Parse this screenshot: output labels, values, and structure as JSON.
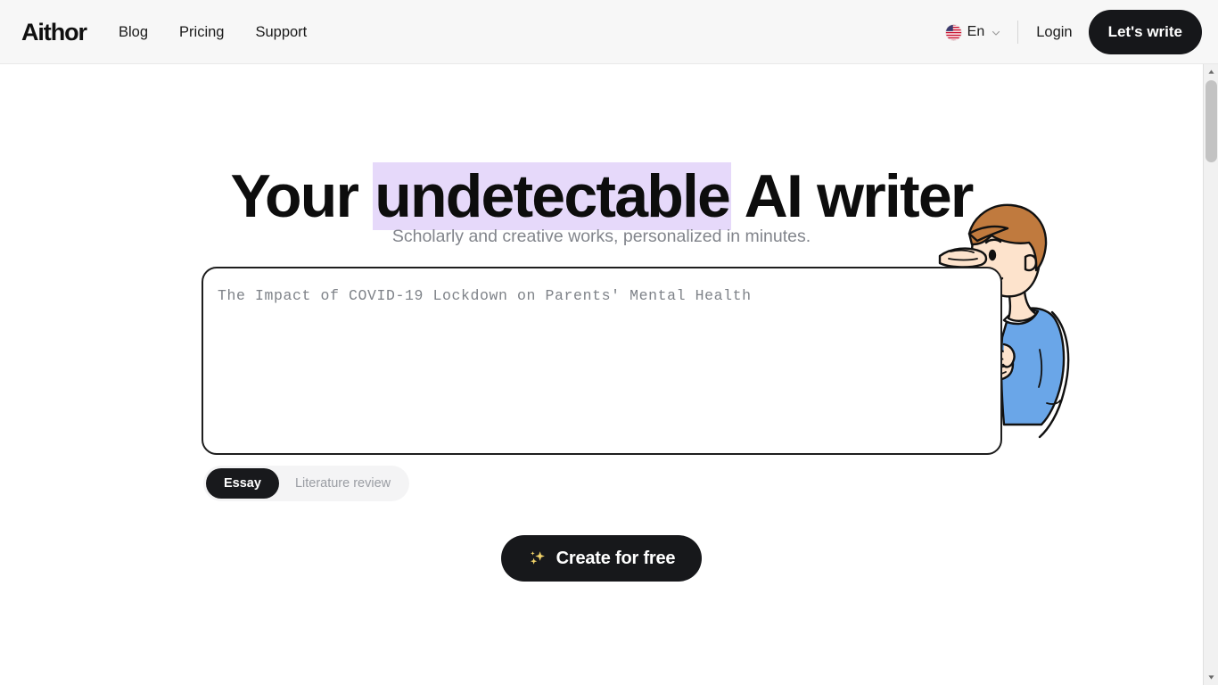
{
  "header": {
    "logo": "Aithor",
    "nav": [
      {
        "label": "Blog",
        "name": "nav-link-blog"
      },
      {
        "label": "Pricing",
        "name": "nav-link-pricing"
      },
      {
        "label": "Support",
        "name": "nav-link-support"
      }
    ],
    "language": {
      "label": "En",
      "flag_icon": "us-flag-icon",
      "chevron_icon": "chevron-down-icon"
    },
    "login_label": "Login",
    "cta_label": "Let's write",
    "background": "#f7f7f7",
    "cta_background": "#16171a"
  },
  "hero": {
    "headline_before": "Your ",
    "headline_highlight": "undetectable",
    "headline_after": " AI writer",
    "highlight_color": "#e6d9fa",
    "subheadline": "Scholarly and creative works, personalized in minutes."
  },
  "prompt": {
    "value": "The Impact of COVID-19 Lockdown on Parents' Mental Health",
    "placeholder": "The Impact of COVID-19 Lockdown on Parents' Mental Health",
    "border_color": "#1e1e1e"
  },
  "type_tabs": [
    {
      "label": "Essay",
      "active": true,
      "name": "tab-essay"
    },
    {
      "label": "Literature review",
      "active": false,
      "name": "tab-literature-review"
    }
  ],
  "create_button": {
    "label": "Create for free",
    "icon": "sparkles-icon",
    "background": "#17181b",
    "icon_color": "#f5d76e"
  },
  "illustration": {
    "name": "boy-peeking-illustration",
    "hair_color": "#c07a3e",
    "shirt_color": "#6aa6e8",
    "skin_color": "#fde3cc"
  },
  "scrollbar": {
    "up_arrow": "scroll-up-arrow-icon",
    "down_arrow": "scroll-down-arrow-icon",
    "thumb_color": "#c3c3c3",
    "track_color": "#f1f1f1"
  }
}
